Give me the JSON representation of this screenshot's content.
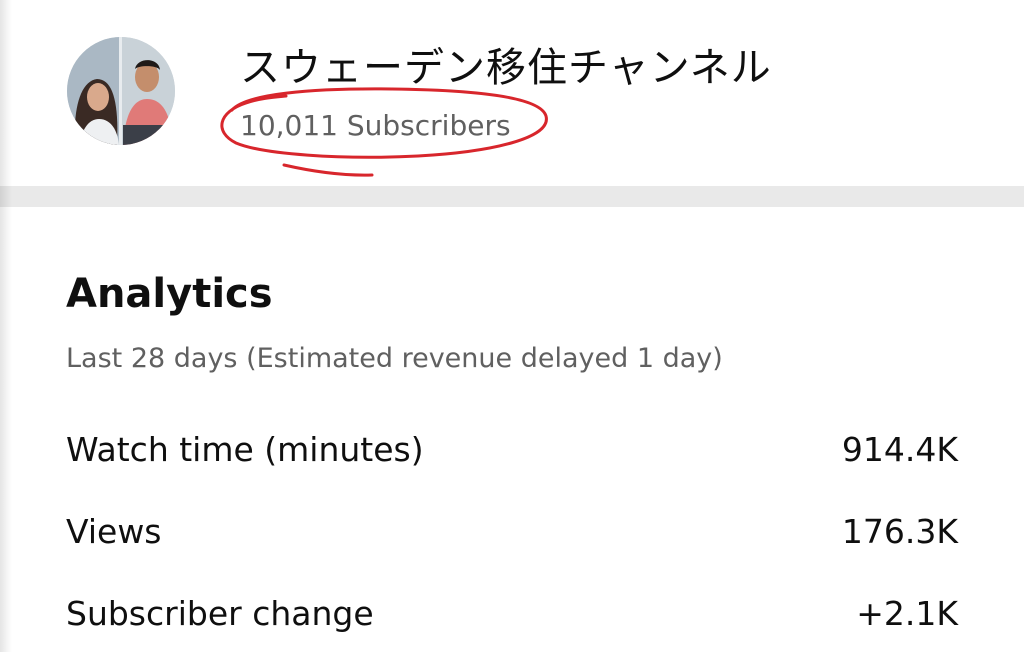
{
  "channel": {
    "name": "スウェーデン移住チャンネル",
    "subscribers": "10,011 Subscribers"
  },
  "analytics": {
    "title": "Analytics",
    "subtitle": "Last 28 days (Estimated revenue delayed 1 day)",
    "metrics": [
      {
        "label": "Watch time (minutes)",
        "value": "914.4K"
      },
      {
        "label": "Views",
        "value": "176.3K"
      },
      {
        "label": "Subscriber change",
        "value": "+2.1K"
      }
    ]
  },
  "colors": {
    "annotation_ink": "#d8262c",
    "primary_text": "#0f0f0f",
    "secondary_text": "#606060",
    "divider": "#e9e9e9"
  },
  "icons": {
    "avatar": "channel-avatar-photo"
  }
}
